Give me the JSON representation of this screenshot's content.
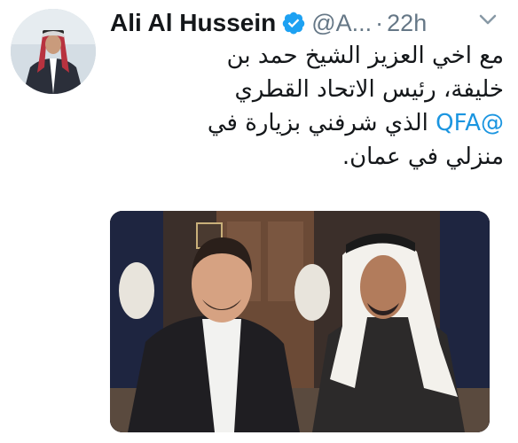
{
  "tweet": {
    "author_name": "Ali Al Hussein",
    "handle": "@A...",
    "separator": "·",
    "time": "22h",
    "text_lines": [
      {
        "before": "مع اخي العزيز  الشيخ حمد بن",
        "mention": "",
        "after": ""
      },
      {
        "before": "خليفة، رئيس الاتحاد القطري",
        "mention": "",
        "after": ""
      },
      {
        "before": "",
        "mention": "@QFA",
        "after": " الذي شرفني بزيارة في"
      },
      {
        "before": "منزلي في عمان.",
        "mention": "",
        "after": ""
      }
    ]
  },
  "icons": {
    "verified": "verified-badge-icon",
    "menu": "chevron-down-icon"
  },
  "colors": {
    "text": "#14171a",
    "secondary": "#657786",
    "link": "#1b95e0",
    "verified": "#1da1f2"
  }
}
